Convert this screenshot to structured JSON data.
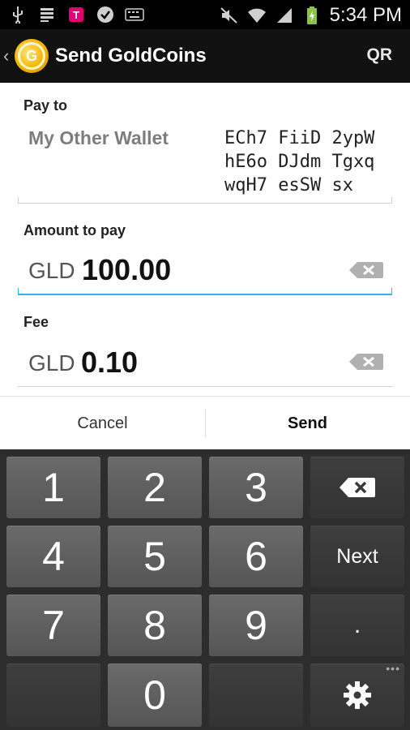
{
  "status_bar": {
    "time": "5:34 PM",
    "icons": [
      "usb-icon",
      "notification-icon",
      "tmobile-icon",
      "check-icon",
      "keyboard-icon",
      "mute-icon",
      "wifi-icon",
      "signal-icon",
      "battery-charging-icon"
    ]
  },
  "action_bar": {
    "title": "Send GoldCoins",
    "qr_label": "QR",
    "logo_letter": "G"
  },
  "form": {
    "pay_to_label": "Pay to",
    "pay_to_name": "My Other Wallet",
    "pay_to_address_lines": [
      "ECh7 FiiD 2ypW",
      "hE6o DJdm Tgxq",
      "wqH7 esSW sx"
    ],
    "amount_label": "Amount to pay",
    "amount_currency": "GLD",
    "amount_value": "100.00",
    "fee_label": "Fee",
    "fee_currency": "GLD",
    "fee_value": "0.10"
  },
  "buttons": {
    "cancel": "Cancel",
    "send": "Send"
  },
  "keypad": {
    "k1": "1",
    "k2": "2",
    "k3": "3",
    "k4": "4",
    "k5": "5",
    "k6": "6",
    "k7": "7",
    "k8": "8",
    "k9": "9",
    "k0": "0",
    "next": "Next",
    "dot": ".",
    "overflow": "•••"
  }
}
